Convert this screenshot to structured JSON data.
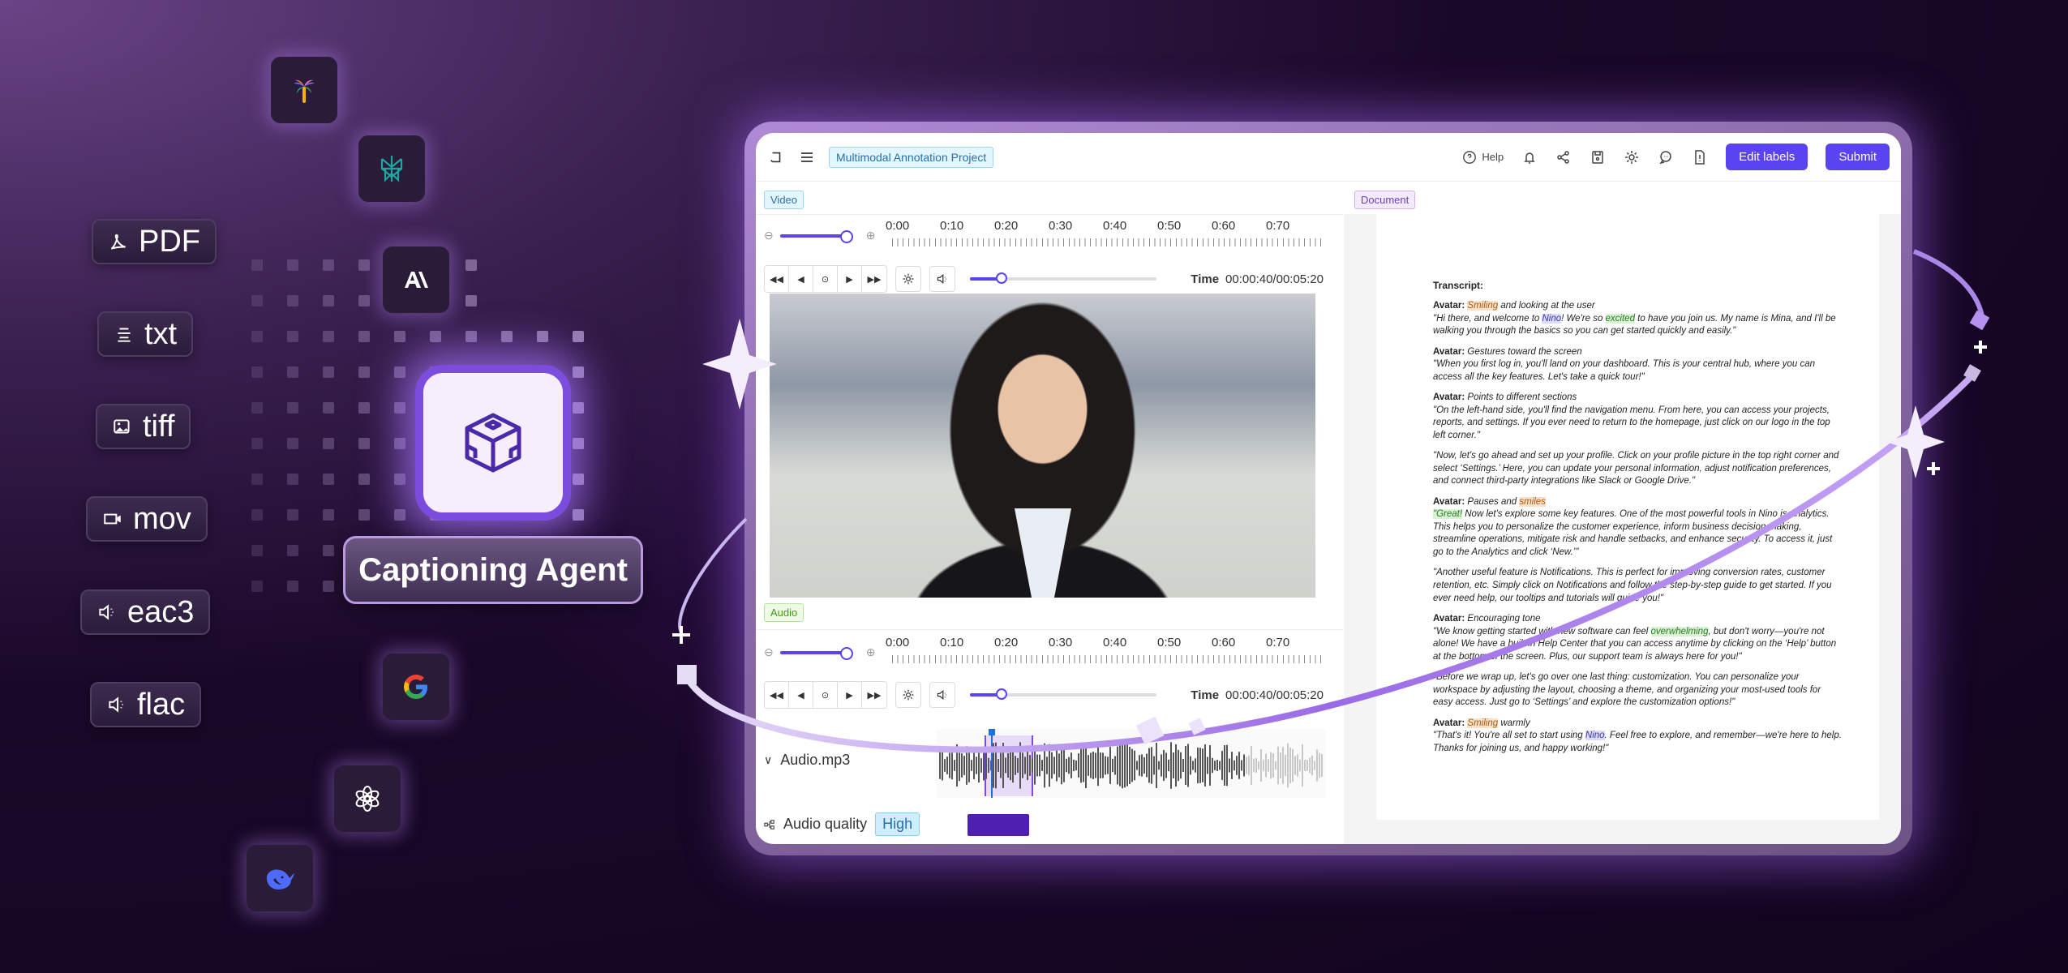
{
  "hero": {
    "agent_label": "Captioning Agent",
    "agent_icon": "cube-icon"
  },
  "file_types": [
    {
      "label": "PDF",
      "icon": "pdf-icon"
    },
    {
      "label": "txt",
      "icon": "text-lines-icon"
    },
    {
      "label": "tiff",
      "icon": "image-icon"
    },
    {
      "label": "mov",
      "icon": "video-camera-icon"
    },
    {
      "label": "eac3",
      "icon": "speaker-icon"
    },
    {
      "label": "flac",
      "icon": "speaker-icon"
    }
  ],
  "model_logos": [
    {
      "name": "palm-tree-logo"
    },
    {
      "name": "perplexity-logo"
    },
    {
      "name": "anthropic-logo",
      "text": "A\\"
    },
    {
      "name": "google-logo",
      "text": "G"
    },
    {
      "name": "openai-logo"
    },
    {
      "name": "deepseek-logo"
    }
  ],
  "app": {
    "project_title": "Multimodal Annotation Project",
    "help_label": "Help",
    "edit_labels_button": "Edit labels",
    "submit_button": "Submit",
    "accent_color": "#5a43f0",
    "sections": {
      "video": "Video",
      "audio": "Audio",
      "document": "Document"
    },
    "timeline_labels": [
      "0:00",
      "0:10",
      "0:20",
      "0:30",
      "0:40",
      "0:50",
      "0:60",
      "0:70"
    ],
    "video_player": {
      "time_label": "Time",
      "time_value": "00:00:40/00:05:20",
      "volume_fraction": 0.17,
      "zoom_fraction": 1.0
    },
    "audio_player": {
      "time_label": "Time",
      "time_value": "00:00:40/00:05:20",
      "volume_fraction": 0.17,
      "zoom_fraction": 1.0,
      "track_name": "Audio.mp3",
      "quality_label": "Audio quality",
      "quality_value": "High"
    },
    "document": {
      "heading": "Transcript:",
      "blocks": [
        {
          "speaker": "Avatar:",
          "action_hl": "Smiling",
          "action_rest": " and looking at the user",
          "quote": [
            "\"Hi there, and welcome to ",
            {
              "hl": "blue",
              "t": "Nino"
            },
            "! We're so ",
            {
              "hl": "green",
              "t": "excited"
            },
            " to have you join us. My name is Mina, and I'll be walking you through the basics so you can get started quickly and easily.\""
          ]
        },
        {
          "speaker": "Avatar:",
          "action_rest": "Gestures toward the screen",
          "quote": [
            "\"When you first log in, you'll land on your dashboard. This is your central hub, where you can access all the key features. Let's take a quick tour!\""
          ]
        },
        {
          "speaker": "Avatar:",
          "action_rest": "Points to different sections",
          "quote": [
            "\"On the left-hand side, you'll find the navigation menu. From here, you can access your projects, reports, and settings. If you ever need to return to the homepage, just click on our logo in the top left corner.\""
          ]
        },
        {
          "quote": [
            "\"Now, let's go ahead and set up your profile. Click on your profile picture in the top right corner and select ‘Settings.’ Here, you can update your personal information, adjust notification preferences, and connect third-party integrations like Slack or Google Drive.\""
          ]
        },
        {
          "speaker": "Avatar:",
          "action_rest": "Pauses and ",
          "action_hl_end": "smiles",
          "quote": [
            {
              "hl": "green",
              "t": "\"Great!"
            },
            " Now let's explore some key features. One of the most powerful tools in Nino is Analytics. This helps you to personalize the customer experience, inform business decision-making, streamline operations, mitigate risk and handle setbacks, and enhance security. To access it, just go to the Analytics and click ‘New.’\""
          ]
        },
        {
          "quote": [
            "\"Another useful feature is Notifications. This is perfect for improving conversion rates, customer retention, etc. Simply click on Notifications and follow the step-by-step guide to get started. If you ever need help, our tooltips and tutorials will guide you!\""
          ]
        },
        {
          "speaker": "Avatar:",
          "action_rest": "Encouraging tone",
          "quote": [
            "\"We know getting started with new software can feel ",
            {
              "hl": "green",
              "t": "overwhelming"
            },
            ", but don't worry—you're not alone! We have a built-in Help Center that you can access anytime by clicking on the ‘Help’ button at the bottom of the screen. Plus, our support team is always here for you!\""
          ]
        },
        {
          "quote": [
            "\"Before we wrap up, let's go over one last thing: customization. You can personalize your workspace by adjusting the layout, choosing a theme, and organizing your most-used tools for easy access. Just go to ‘Settings’ and explore the customization options!\""
          ]
        },
        {
          "speaker": "Avatar:",
          "action_hl": "Smiling",
          "action_rest": " warmly",
          "quote": [
            "\"That's it! You're all set to start using ",
            {
              "hl": "blue",
              "t": "Nino"
            },
            ". Feel free to explore, and remember—we're here to help. Thanks for joining us, and happy working!\""
          ]
        }
      ]
    }
  }
}
